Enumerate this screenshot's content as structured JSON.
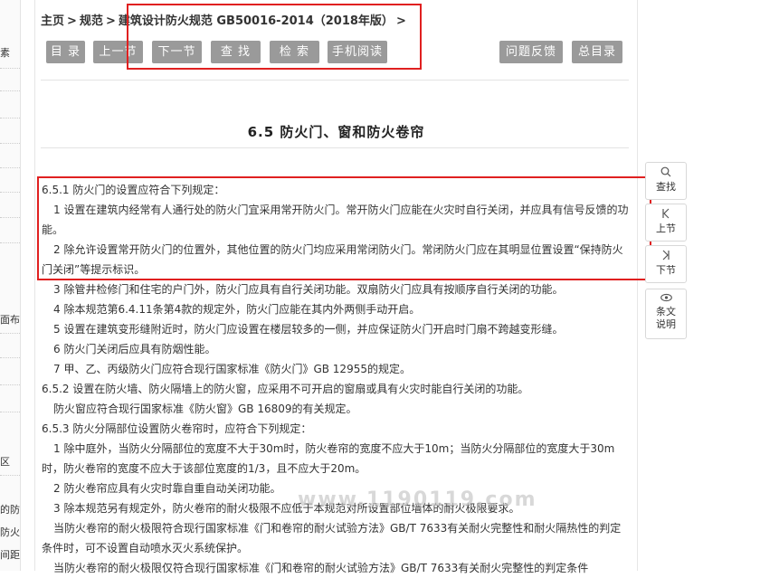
{
  "breadcrumb": {
    "home": "主页",
    "sep": ">",
    "level2": "规范",
    "level3": "建筑设计防火规范 GB50016-2014（2018年版）",
    "trailing": ">"
  },
  "toolbar": {
    "catalog": "目 录",
    "prev_section": "上一节",
    "next_section": "下一节",
    "find": "查 找",
    "search": "检 索",
    "mobile_read": "手机阅读",
    "feedback": "问题反馈",
    "master_catalog": "总目录"
  },
  "section_title": "6.5 防火门、窗和防火卷帘",
  "paragraphs": [
    "6.5.1 防火门的设置应符合下列规定：",
    "1 设置在建筑内经常有人通行处的防火门宜采用常开防火门。常开防火门应能在火灾时自行关闭，并应具有信号反馈的功能。",
    "2 除允许设置常开防火门的位置外，其他位置的防火门均应采用常闭防火门。常闭防火门应在其明显位置设置“保持防火门关闭”等提示标识。",
    "3 除管井检修门和住宅的户门外，防火门应具有自行关闭功能。双扇防火门应具有按顺序自行关闭的功能。",
    "4 除本规范第6.4.11条第4款的规定外，防火门应能在其内外两侧手动开启。",
    "5 设置在建筑变形缝附近时，防火门应设置在楼层较多的一侧，并应保证防火门开启时门扇不跨越变形缝。",
    "6 防火门关闭后应具有防烟性能。",
    "7 甲、乙、丙级防火门应符合现行国家标准《防火门》GB 12955的规定。",
    "6.5.2 设置在防火墙、防火隔墙上的防火窗，应采用不可开启的窗扇或具有火灾时能自行关闭的功能。",
    "防火窗应符合现行国家标准《防火窗》GB 16809的有关规定。",
    "6.5.3 防火分隔部位设置防火卷帘时，应符合下列规定：",
    "1 除中庭外，当防火分隔部位的宽度不大于30m时，防火卷帘的宽度不应大于10m；当防火分隔部位的宽度大于30m时，防火卷帘的宽度不应大于该部位宽度的1/3，且不应大于20m。",
    "2 防火卷帘应具有火灾时靠自重自动关闭功能。",
    "3 除本规范另有规定外，防火卷帘的耐火极限不应低于本规范对所设置部位墙体的耐火极限要求。",
    "当防火卷帘的耐火极限符合现行国家标准《门和卷帘的耐火试验方法》GB/T 7633有关耐火完整性和耐火隔热性的判定条件时，可不设置自动喷水灭火系统保护。",
    "当防火卷帘的耐火极限仅符合现行国家标准《门和卷帘的耐火试验方法》GB/T 7633有关耐火完整性的判定条件"
  ],
  "watermark": "www.1190119.com",
  "side_tools": {
    "find": "查找",
    "prev": "上节",
    "next": "下节",
    "notes_line1": "条文",
    "notes_line2": "说明"
  },
  "left_fragments": [
    "素",
    "面布",
    "区",
    "的防",
    "防火",
    "间距"
  ],
  "colors": {
    "button_gray": "#9a9a9a",
    "highlight_red": "#e02020"
  }
}
